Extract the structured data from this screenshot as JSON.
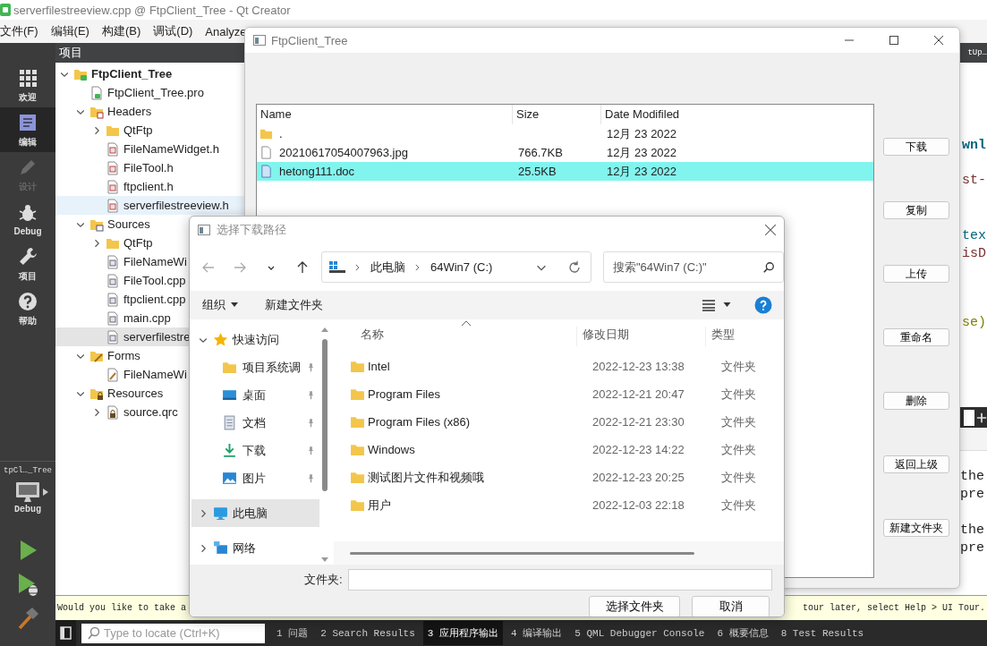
{
  "ide": {
    "title": "serverfilestreeview.cpp @ FtpClient_Tree - Qt Creator",
    "menu": [
      "文件(F)",
      "编辑(E)",
      "构建(B)",
      "调试(D)",
      "Analyze"
    ],
    "modes": [
      {
        "label": "欢迎",
        "kind": "welcome",
        "selected": false,
        "disabled": false
      },
      {
        "label": "编辑",
        "kind": "edit",
        "selected": true,
        "disabled": false
      },
      {
        "label": "设计",
        "kind": "design",
        "selected": false,
        "disabled": true
      },
      {
        "label": "Debug",
        "kind": "debug",
        "selected": false,
        "disabled": false
      },
      {
        "label": "项目",
        "kind": "projects",
        "selected": false,
        "disabled": false
      },
      {
        "label": "帮助",
        "kind": "help",
        "selected": false,
        "disabled": false
      }
    ],
    "target": {
      "project": "tpCl…_Tree",
      "config": "Debug"
    },
    "project_panel": {
      "title": "项目",
      "tree": [
        {
          "label": "FtpClient_Tree",
          "kind": "qt-folder",
          "expanded": true,
          "selected": false,
          "hovered": false,
          "children": [
            {
              "label": "FtpClient_Tree.pro",
              "kind": "pro",
              "selected": false,
              "hovered": false
            },
            {
              "label": "Headers",
              "kind": "h-folder",
              "expanded": true,
              "selected": false,
              "hovered": false,
              "children": [
                {
                  "label": "QtFtp",
                  "kind": "folder",
                  "expanded": false,
                  "selected": false,
                  "hovered": false
                },
                {
                  "label": "FileNameWidget.h",
                  "kind": "h",
                  "selected": false,
                  "hovered": false
                },
                {
                  "label": "FileTool.h",
                  "kind": "h",
                  "selected": false,
                  "hovered": false
                },
                {
                  "label": "ftpclient.h",
                  "kind": "h",
                  "selected": false,
                  "hovered": false
                },
                {
                  "label": "serverfilestreeview.h",
                  "kind": "h",
                  "selected": false,
                  "hovered": true
                }
              ]
            },
            {
              "label": "Sources",
              "kind": "cpp-folder",
              "expanded": true,
              "selected": false,
              "hovered": false,
              "children": [
                {
                  "label": "QtFtp",
                  "kind": "folder",
                  "expanded": false,
                  "selected": false,
                  "hovered": false
                },
                {
                  "label": "FileNameWi",
                  "kind": "cpp",
                  "selected": false,
                  "hovered": false
                },
                {
                  "label": "FileTool.cpp",
                  "kind": "cpp",
                  "selected": false,
                  "hovered": false
                },
                {
                  "label": "ftpclient.cpp",
                  "kind": "cpp",
                  "selected": false,
                  "hovered": false
                },
                {
                  "label": "main.cpp",
                  "kind": "cpp",
                  "selected": false,
                  "hovered": false
                },
                {
                  "label": "serverfilestre",
                  "kind": "cpp",
                  "selected": true,
                  "hovered": false
                }
              ]
            },
            {
              "label": "Forms",
              "kind": "forms-folder",
              "expanded": true,
              "selected": false,
              "hovered": false,
              "children": [
                {
                  "label": "FileNameWi",
                  "kind": "ui",
                  "selected": false,
                  "hovered": false
                }
              ]
            },
            {
              "label": "Resources",
              "kind": "res-folder",
              "expanded": true,
              "selected": false,
              "hovered": false,
              "children": [
                {
                  "label": "source.qrc",
                  "kind": "qrc",
                  "expanded": false,
                  "selected": false,
                  "hovered": false
                }
              ]
            }
          ]
        }
      ]
    },
    "editor": {
      "tab_fragment": "tUp…",
      "code_fragments": [
        {
          "text": "wnl",
          "color": "#00677c"
        },
        {
          "text": "st-",
          "color": "#7a2e2e"
        },
        {
          "text": "tex",
          "color": "#00677c"
        },
        {
          "text": "isD",
          "color": "#7a2e2e"
        },
        {
          "text": "se)",
          "color": "#808000"
        }
      ],
      "output_fragments": [
        "the",
        "pre",
        "the",
        "pre"
      ]
    },
    "info_bar": {
      "text_left": "Would you like to take a",
      "text_right": "tour later, select Help > UI Tour."
    },
    "status_bar": {
      "locate": {
        "placeholder": "Type to locate (Ctrl+K)"
      },
      "panes": [
        {
          "label": "1 问题",
          "selected": false
        },
        {
          "label": "2 Search Results",
          "selected": false
        },
        {
          "label": "3 应用程序输出",
          "selected": true
        },
        {
          "label": "4 编译输出",
          "selected": false
        },
        {
          "label": "5 QML Debugger Console",
          "selected": false
        },
        {
          "label": "6 概要信息",
          "selected": false
        },
        {
          "label": "8 Test Results",
          "selected": false
        }
      ]
    }
  },
  "ftp_window": {
    "title": "FtpClient_Tree",
    "columns": [
      "Name",
      "Size",
      "Date Modifiled"
    ],
    "rows": [
      {
        "kind": "folder",
        "name": ".",
        "date": "12月 23 2022",
        "selected": false
      },
      {
        "kind": "file",
        "name": "20210617054007963.jpg",
        "size": "766.7KB",
        "date": "12月 23 2022",
        "selected": false
      },
      {
        "kind": "doc",
        "name": "hetong111.doc",
        "size": "25.5KB",
        "date": "12月 23 2022",
        "selected": true
      }
    ],
    "buttons": [
      "下载",
      "复制",
      "上传",
      "重命名",
      "删除",
      "返回上级",
      "新建文件夹"
    ]
  },
  "folder_dialog": {
    "title": "选择下载路径",
    "nav_buttons": [
      {
        "kind": "back",
        "disabled": true
      },
      {
        "kind": "forward",
        "disabled": true
      },
      {
        "kind": "recent",
        "disabled": false
      },
      {
        "kind": "up",
        "disabled": false
      }
    ],
    "breadcrumb": [
      "此电脑",
      "64Win7 (C:)"
    ],
    "search": {
      "placeholder": "搜索\"64Win7 (C:)\""
    },
    "toolbar": {
      "organize": "组织",
      "new_folder": "新建文件夹"
    },
    "nav": [
      {
        "label": "快速访问",
        "kind": "star",
        "expanded": true,
        "selected": false,
        "children": [
          {
            "label": "项目系统调",
            "kind": "folder",
            "pinned": true,
            "selected": false
          },
          {
            "label": "桌面",
            "kind": "desktop",
            "pinned": true,
            "selected": false
          },
          {
            "label": "文档",
            "kind": "documents",
            "pinned": true,
            "selected": false
          },
          {
            "label": "下载",
            "kind": "downloads",
            "pinned": true,
            "selected": false
          },
          {
            "label": "图片",
            "kind": "pictures",
            "pinned": true,
            "selected": false
          }
        ]
      },
      {
        "label": "此电脑",
        "kind": "pc",
        "expanded": false,
        "selected": true
      },
      {
        "label": "网络",
        "kind": "network",
        "expanded": false,
        "selected": false
      }
    ],
    "columns": [
      "名称",
      "修改日期",
      "类型"
    ],
    "rows": [
      {
        "name": "Intel",
        "modified": "2022-12-23 13:38",
        "type": "文件夹"
      },
      {
        "name": "Program Files",
        "modified": "2022-12-21 20:47",
        "type": "文件夹"
      },
      {
        "name": "Program Files (x86)",
        "modified": "2022-12-21 23:30",
        "type": "文件夹"
      },
      {
        "name": "Windows",
        "modified": "2022-12-23 14:22",
        "type": "文件夹"
      },
      {
        "name": "测试图片文件和视频哦",
        "modified": "2022-12-23 20:25",
        "type": "文件夹"
      },
      {
        "name": "用户",
        "modified": "2022-12-03 22:18",
        "type": "文件夹"
      }
    ],
    "folder_label": "文件夹:",
    "buttons": [
      "选择文件夹",
      "取消"
    ]
  }
}
